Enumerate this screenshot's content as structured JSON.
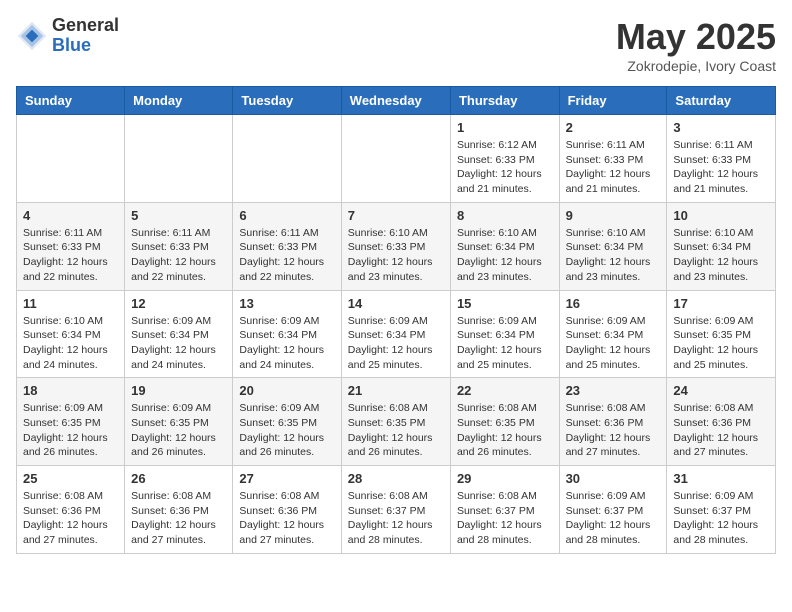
{
  "header": {
    "logo_general": "General",
    "logo_blue": "Blue",
    "month_title": "May 2025",
    "location": "Zokrodepie, Ivory Coast"
  },
  "weekdays": [
    "Sunday",
    "Monday",
    "Tuesday",
    "Wednesday",
    "Thursday",
    "Friday",
    "Saturday"
  ],
  "weeks": [
    [
      {
        "day": "",
        "content": ""
      },
      {
        "day": "",
        "content": ""
      },
      {
        "day": "",
        "content": ""
      },
      {
        "day": "",
        "content": ""
      },
      {
        "day": "1",
        "content": "Sunrise: 6:12 AM\nSunset: 6:33 PM\nDaylight: 12 hours\nand 21 minutes."
      },
      {
        "day": "2",
        "content": "Sunrise: 6:11 AM\nSunset: 6:33 PM\nDaylight: 12 hours\nand 21 minutes."
      },
      {
        "day": "3",
        "content": "Sunrise: 6:11 AM\nSunset: 6:33 PM\nDaylight: 12 hours\nand 21 minutes."
      }
    ],
    [
      {
        "day": "4",
        "content": "Sunrise: 6:11 AM\nSunset: 6:33 PM\nDaylight: 12 hours\nand 22 minutes."
      },
      {
        "day": "5",
        "content": "Sunrise: 6:11 AM\nSunset: 6:33 PM\nDaylight: 12 hours\nand 22 minutes."
      },
      {
        "day": "6",
        "content": "Sunrise: 6:11 AM\nSunset: 6:33 PM\nDaylight: 12 hours\nand 22 minutes."
      },
      {
        "day": "7",
        "content": "Sunrise: 6:10 AM\nSunset: 6:33 PM\nDaylight: 12 hours\nand 23 minutes."
      },
      {
        "day": "8",
        "content": "Sunrise: 6:10 AM\nSunset: 6:34 PM\nDaylight: 12 hours\nand 23 minutes."
      },
      {
        "day": "9",
        "content": "Sunrise: 6:10 AM\nSunset: 6:34 PM\nDaylight: 12 hours\nand 23 minutes."
      },
      {
        "day": "10",
        "content": "Sunrise: 6:10 AM\nSunset: 6:34 PM\nDaylight: 12 hours\nand 23 minutes."
      }
    ],
    [
      {
        "day": "11",
        "content": "Sunrise: 6:10 AM\nSunset: 6:34 PM\nDaylight: 12 hours\nand 24 minutes."
      },
      {
        "day": "12",
        "content": "Sunrise: 6:09 AM\nSunset: 6:34 PM\nDaylight: 12 hours\nand 24 minutes."
      },
      {
        "day": "13",
        "content": "Sunrise: 6:09 AM\nSunset: 6:34 PM\nDaylight: 12 hours\nand 24 minutes."
      },
      {
        "day": "14",
        "content": "Sunrise: 6:09 AM\nSunset: 6:34 PM\nDaylight: 12 hours\nand 25 minutes."
      },
      {
        "day": "15",
        "content": "Sunrise: 6:09 AM\nSunset: 6:34 PM\nDaylight: 12 hours\nand 25 minutes."
      },
      {
        "day": "16",
        "content": "Sunrise: 6:09 AM\nSunset: 6:34 PM\nDaylight: 12 hours\nand 25 minutes."
      },
      {
        "day": "17",
        "content": "Sunrise: 6:09 AM\nSunset: 6:35 PM\nDaylight: 12 hours\nand 25 minutes."
      }
    ],
    [
      {
        "day": "18",
        "content": "Sunrise: 6:09 AM\nSunset: 6:35 PM\nDaylight: 12 hours\nand 26 minutes."
      },
      {
        "day": "19",
        "content": "Sunrise: 6:09 AM\nSunset: 6:35 PM\nDaylight: 12 hours\nand 26 minutes."
      },
      {
        "day": "20",
        "content": "Sunrise: 6:09 AM\nSunset: 6:35 PM\nDaylight: 12 hours\nand 26 minutes."
      },
      {
        "day": "21",
        "content": "Sunrise: 6:08 AM\nSunset: 6:35 PM\nDaylight: 12 hours\nand 26 minutes."
      },
      {
        "day": "22",
        "content": "Sunrise: 6:08 AM\nSunset: 6:35 PM\nDaylight: 12 hours\nand 26 minutes."
      },
      {
        "day": "23",
        "content": "Sunrise: 6:08 AM\nSunset: 6:36 PM\nDaylight: 12 hours\nand 27 minutes."
      },
      {
        "day": "24",
        "content": "Sunrise: 6:08 AM\nSunset: 6:36 PM\nDaylight: 12 hours\nand 27 minutes."
      }
    ],
    [
      {
        "day": "25",
        "content": "Sunrise: 6:08 AM\nSunset: 6:36 PM\nDaylight: 12 hours\nand 27 minutes."
      },
      {
        "day": "26",
        "content": "Sunrise: 6:08 AM\nSunset: 6:36 PM\nDaylight: 12 hours\nand 27 minutes."
      },
      {
        "day": "27",
        "content": "Sunrise: 6:08 AM\nSunset: 6:36 PM\nDaylight: 12 hours\nand 27 minutes."
      },
      {
        "day": "28",
        "content": "Sunrise: 6:08 AM\nSunset: 6:37 PM\nDaylight: 12 hours\nand 28 minutes."
      },
      {
        "day": "29",
        "content": "Sunrise: 6:08 AM\nSunset: 6:37 PM\nDaylight: 12 hours\nand 28 minutes."
      },
      {
        "day": "30",
        "content": "Sunrise: 6:09 AM\nSunset: 6:37 PM\nDaylight: 12 hours\nand 28 minutes."
      },
      {
        "day": "31",
        "content": "Sunrise: 6:09 AM\nSunset: 6:37 PM\nDaylight: 12 hours\nand 28 minutes."
      }
    ]
  ]
}
